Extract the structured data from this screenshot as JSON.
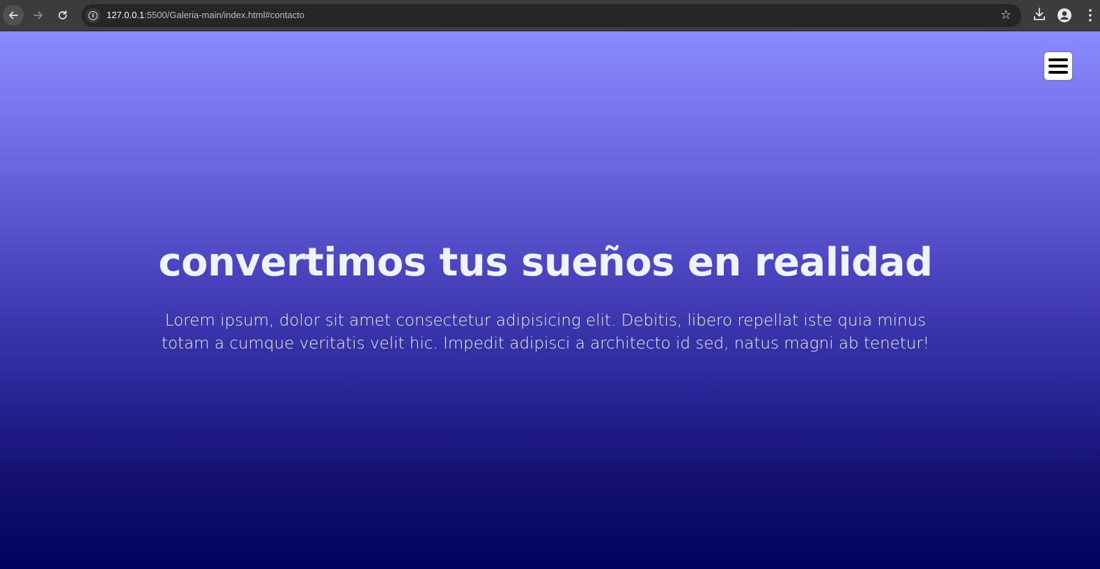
{
  "browser": {
    "url_host": "127.0.0.1",
    "url_rest": ":5500/Galeria-main/index.html#contacto"
  },
  "icons": {
    "back": "arrow-left-icon",
    "forward": "arrow-right-icon",
    "reload": "reload-icon",
    "info": "info-icon",
    "bookmark": "star-icon",
    "download": "download-icon",
    "profile": "profile-icon",
    "menu": "vertical-dots-icon",
    "hamburger": "hamburger-menu-icon"
  },
  "colors": {
    "gradient_top": "#8a8aff",
    "gradient_bottom": "#02025f",
    "hero_text": "#eef3ff"
  },
  "hero": {
    "title": "convertimos tus sueños en realidad",
    "text": "Lorem ipsum, dolor sit amet consectetur adipisicing elit. Debitis, libero repellat iste quia minus totam a cumque veritatis velit hic. Impedit adipisci a architecto id sed, natus magni ab tenetur!"
  }
}
